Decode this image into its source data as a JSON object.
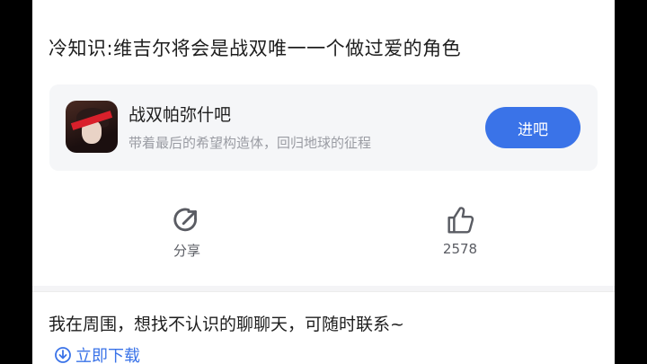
{
  "post": {
    "title": "冷知识:维吉尔将会是战双唯一一个做过爱的角色"
  },
  "forum": {
    "name": "战双帕弥什吧",
    "description": "带着最后的希望构造体，回归地球的征程",
    "enter_label": "进吧",
    "accent_color": "#3a73e8"
  },
  "actions": {
    "share_label": "分享",
    "share_icon": "share-icon",
    "like_count": "2578",
    "like_icon": "thumbs-up-icon"
  },
  "ad": {
    "text": "我在周围，想找不认识的聊聊天，可随时联系~",
    "download_label": "立即下载",
    "download_icon": "download-icon"
  }
}
